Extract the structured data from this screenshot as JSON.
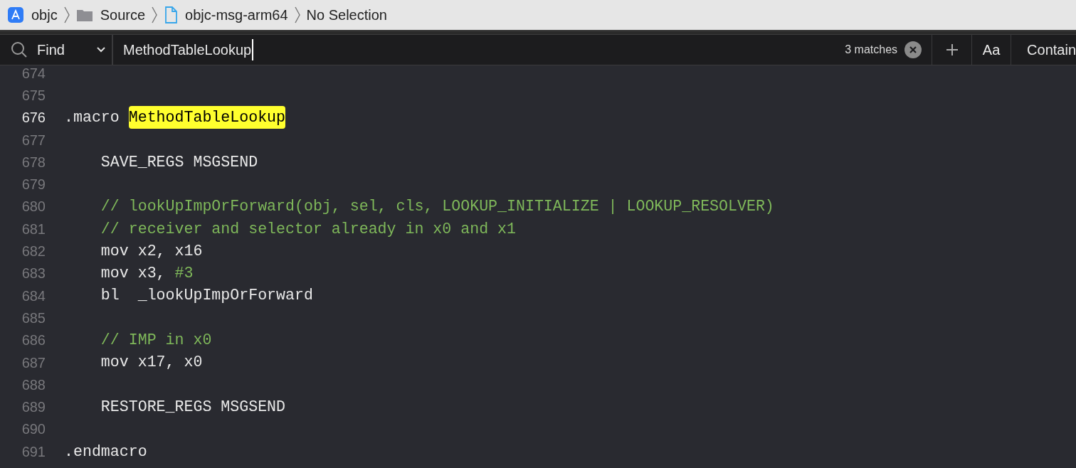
{
  "breadcrumbs": [
    {
      "label": "objc",
      "kind": "app"
    },
    {
      "label": "Source",
      "kind": "folder"
    },
    {
      "label": "objc-msg-arm64",
      "kind": "file"
    },
    {
      "label": "No Selection",
      "kind": "plain"
    }
  ],
  "find_bar": {
    "mode": "Find",
    "query": "MethodTableLookup",
    "match_count": "3 matches",
    "case_button": "Aa",
    "match_mode": "Contain"
  },
  "lines": [
    {
      "number": "674",
      "current": false
    },
    {
      "number": "675",
      "current": false
    },
    {
      "number": "676",
      "current": true,
      "tokens": [
        {
          "text": ".macro ",
          "kind": "plain"
        },
        {
          "text": "MethodTableLookup",
          "kind": "match"
        }
      ]
    },
    {
      "number": "677",
      "current": false
    },
    {
      "number": "678",
      "current": false,
      "tokens": [
        {
          "text": "    SAVE_REGS MSGSEND",
          "kind": "plain"
        }
      ]
    },
    {
      "number": "679",
      "current": false
    },
    {
      "number": "680",
      "current": false,
      "tokens": [
        {
          "text": "    // lookUpImpOrForward(obj, sel, cls, LOOKUP_INITIALIZE | LOOKUP_RESOLVER)",
          "kind": "comment"
        }
      ]
    },
    {
      "number": "681",
      "current": false,
      "tokens": [
        {
          "text": "    // receiver and selector already in x0 and x1",
          "kind": "comment"
        }
      ]
    },
    {
      "number": "682",
      "current": false,
      "tokens": [
        {
          "text": "    mov x2, x16",
          "kind": "plain"
        }
      ]
    },
    {
      "number": "683",
      "current": false,
      "tokens": [
        {
          "text": "    mov x3, ",
          "kind": "plain"
        },
        {
          "text": "#3",
          "kind": "number"
        }
      ]
    },
    {
      "number": "684",
      "current": false,
      "tokens": [
        {
          "text": "    bl  _lookUpImpOrForward",
          "kind": "plain"
        }
      ]
    },
    {
      "number": "685",
      "current": false
    },
    {
      "number": "686",
      "current": false,
      "tokens": [
        {
          "text": "    // IMP in x0",
          "kind": "comment"
        }
      ]
    },
    {
      "number": "687",
      "current": false,
      "tokens": [
        {
          "text": "    mov x17, x0",
          "kind": "plain"
        }
      ]
    },
    {
      "number": "688",
      "current": false
    },
    {
      "number": "689",
      "current": false,
      "tokens": [
        {
          "text": "    RESTORE_REGS MSGSEND",
          "kind": "plain"
        }
      ]
    },
    {
      "number": "690",
      "current": false
    },
    {
      "number": "691",
      "current": false,
      "tokens": [
        {
          "text": ".endmacro",
          "kind": "plain"
        }
      ]
    }
  ]
}
